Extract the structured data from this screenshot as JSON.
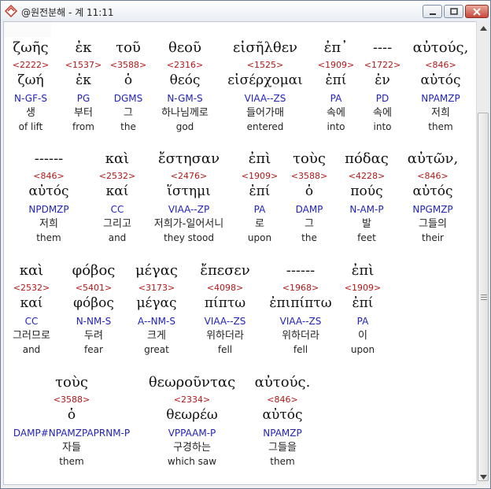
{
  "window": {
    "title": "@원전분해 - 계 11:11",
    "buttons": {
      "minimize": "–",
      "maximize": "□",
      "close": "✕"
    }
  },
  "words": [
    {
      "greek": "ζωῆς",
      "strong": "<2222>",
      "lemma": "ζωή",
      "parse": "N-GF-S",
      "kor": "생",
      "eng": "of lift"
    },
    {
      "greek": "ἐκ",
      "strong": "<1537>",
      "lemma": "ἐκ",
      "parse": "PG",
      "kor": "부터",
      "eng": "from"
    },
    {
      "greek": "τοῦ",
      "strong": "<3588>",
      "lemma": "ὁ",
      "parse": "DGMS",
      "kor": "그",
      "eng": "the"
    },
    {
      "greek": "θεοῦ",
      "strong": "<2316>",
      "lemma": "θεός",
      "parse": "N-GM-S",
      "kor": "하나님께로",
      "eng": "god"
    },
    {
      "greek": "εἰσῆλθεν",
      "strong": "<1525>",
      "lemma": "εἰσέρχομαι",
      "parse": "VIAA--ZS",
      "kor": "들어가매",
      "eng": "entered"
    },
    {
      "greek": "ἐπ᾽",
      "strong": "<1909>",
      "lemma": "ἐπί",
      "parse": "PA",
      "kor": "속에",
      "eng": "into"
    },
    {
      "greek": "----",
      "strong": "<1722>",
      "lemma": "ἐν",
      "parse": "PD",
      "kor": "속에",
      "eng": "into"
    },
    {
      "greek": "αὐτούς,",
      "strong": "<846>",
      "lemma": "αὐτός",
      "parse": "NPAMZP",
      "kor": "저희",
      "eng": "them"
    },
    {
      "greek": "------",
      "strong": "<846>",
      "lemma": "αὐτός",
      "parse": "NPDMZP",
      "kor": "저희",
      "eng": "them"
    },
    {
      "greek": "καὶ",
      "strong": "<2532>",
      "lemma": "καί",
      "parse": "CC",
      "kor": "그리고",
      "eng": "and"
    },
    {
      "greek": "ἔστησαν",
      "strong": "<2476>",
      "lemma": "ἵστημι",
      "parse": "VIAA--ZP",
      "kor": "저희가-일어서니",
      "eng": "they stood"
    },
    {
      "greek": "ἐπὶ",
      "strong": "<1909>",
      "lemma": "ἐπί",
      "parse": "PA",
      "kor": "로",
      "eng": "upon"
    },
    {
      "greek": "τοὺς",
      "strong": "<3588>",
      "lemma": "ὁ",
      "parse": "DAMP",
      "kor": "그",
      "eng": "the"
    },
    {
      "greek": "πόδας",
      "strong": "<4228>",
      "lemma": "πούς",
      "parse": "N-AM-P",
      "kor": "발",
      "eng": "feet"
    },
    {
      "greek": "αὐτῶν,",
      "strong": "<846>",
      "lemma": "αὐτός",
      "parse": "NPGMZP",
      "kor": "그들의",
      "eng": "their"
    },
    {
      "greek": "καὶ",
      "strong": "<2532>",
      "lemma": "καί",
      "parse": "CC",
      "kor": "그러므로",
      "eng": "and"
    },
    {
      "greek": "φόβος",
      "strong": "<5401>",
      "lemma": "φόβος",
      "parse": "N-NM-S",
      "kor": "두려",
      "eng": "fear"
    },
    {
      "greek": "μέγας",
      "strong": "<3173>",
      "lemma": "μέγας",
      "parse": "A--NM-S",
      "kor": "크게",
      "eng": "great"
    },
    {
      "greek": "ἔπεσεν",
      "strong": "<4098>",
      "lemma": "πίπτω",
      "parse": "VIAA--ZS",
      "kor": "위하더라",
      "eng": "fell"
    },
    {
      "greek": "------",
      "strong": "<1968>",
      "lemma": "ἐπιπίπτω",
      "parse": "VIAA--ZS",
      "kor": "위하더라",
      "eng": "fell"
    },
    {
      "greek": "ἐπὶ",
      "strong": "<1909>",
      "lemma": "ἐπί",
      "parse": "PA",
      "kor": "이",
      "eng": "upon"
    },
    {
      "greek": "τοὺς",
      "strong": "<3588>",
      "lemma": "ὁ",
      "parse": "DAMP#NPAMZPAPRNM-P",
      "kor": "자들",
      "eng": "them"
    },
    {
      "greek": "θεωροῦντας",
      "strong": "<2334>",
      "lemma": "θεωρέω",
      "parse": "VPPAAM-P",
      "kor": "구경하는",
      "eng": "which saw"
    },
    {
      "greek": "αὐτούς.",
      "strong": "<846>",
      "lemma": "αὐτός",
      "parse": "NPAMZP",
      "kor": "그들을",
      "eng": "them"
    }
  ]
}
